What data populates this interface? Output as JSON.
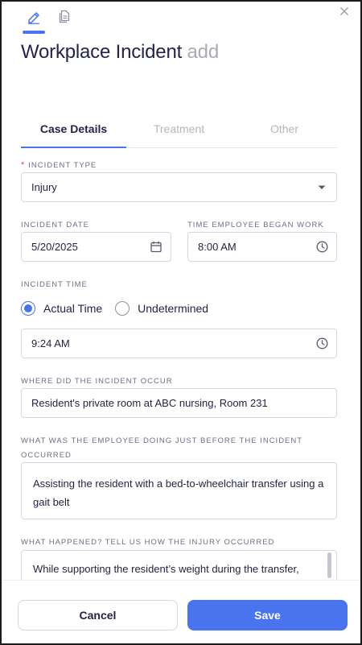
{
  "window": {
    "title": "Workplace Incident",
    "title_suffix": "add"
  },
  "modes": [
    {
      "icon": "edit-pencil-icon",
      "active": true
    },
    {
      "icon": "document-copy-icon",
      "active": false
    }
  ],
  "tabs": [
    {
      "label": "Case Details",
      "active": true
    },
    {
      "label": "Treatment",
      "active": false
    },
    {
      "label": "Other",
      "active": false
    }
  ],
  "form": {
    "incident_type": {
      "label": "INCIDENT TYPE",
      "required": true,
      "value": "Injury"
    },
    "incident_date": {
      "label": "INCIDENT DATE",
      "value": "5/20/2025"
    },
    "time_began_work": {
      "label": "TIME EMPLOYEE BEGAN WORK",
      "value": "8:00 AM"
    },
    "incident_time": {
      "label": "INCIDENT TIME",
      "options": [
        "Actual Time",
        "Undetermined"
      ],
      "selected": "Actual Time",
      "value": "9:24 AM"
    },
    "location": {
      "label": "WHERE DID THE INCIDENT OCCUR",
      "value": "Resident's private room at ABC nursing, Room 231"
    },
    "activity_before": {
      "label": "WHAT WAS THE EMPLOYEE DOING JUST BEFORE THE INCIDENT OCCURRED",
      "value": "Assisting the resident with a bed-to-wheelchair transfer using a gait belt"
    },
    "what_happened": {
      "label": "WHAT HAPPENED? TELL US HOW THE INJURY OCCURRED",
      "value": "While supporting the resident’s weight during the transfer,"
    }
  },
  "footer": {
    "cancel_label": "Cancel",
    "save_label": "Save"
  },
  "colors": {
    "accent": "#4a73f0",
    "required": "#e5484d",
    "title": "#22244a",
    "muted": "#a9abb5"
  }
}
